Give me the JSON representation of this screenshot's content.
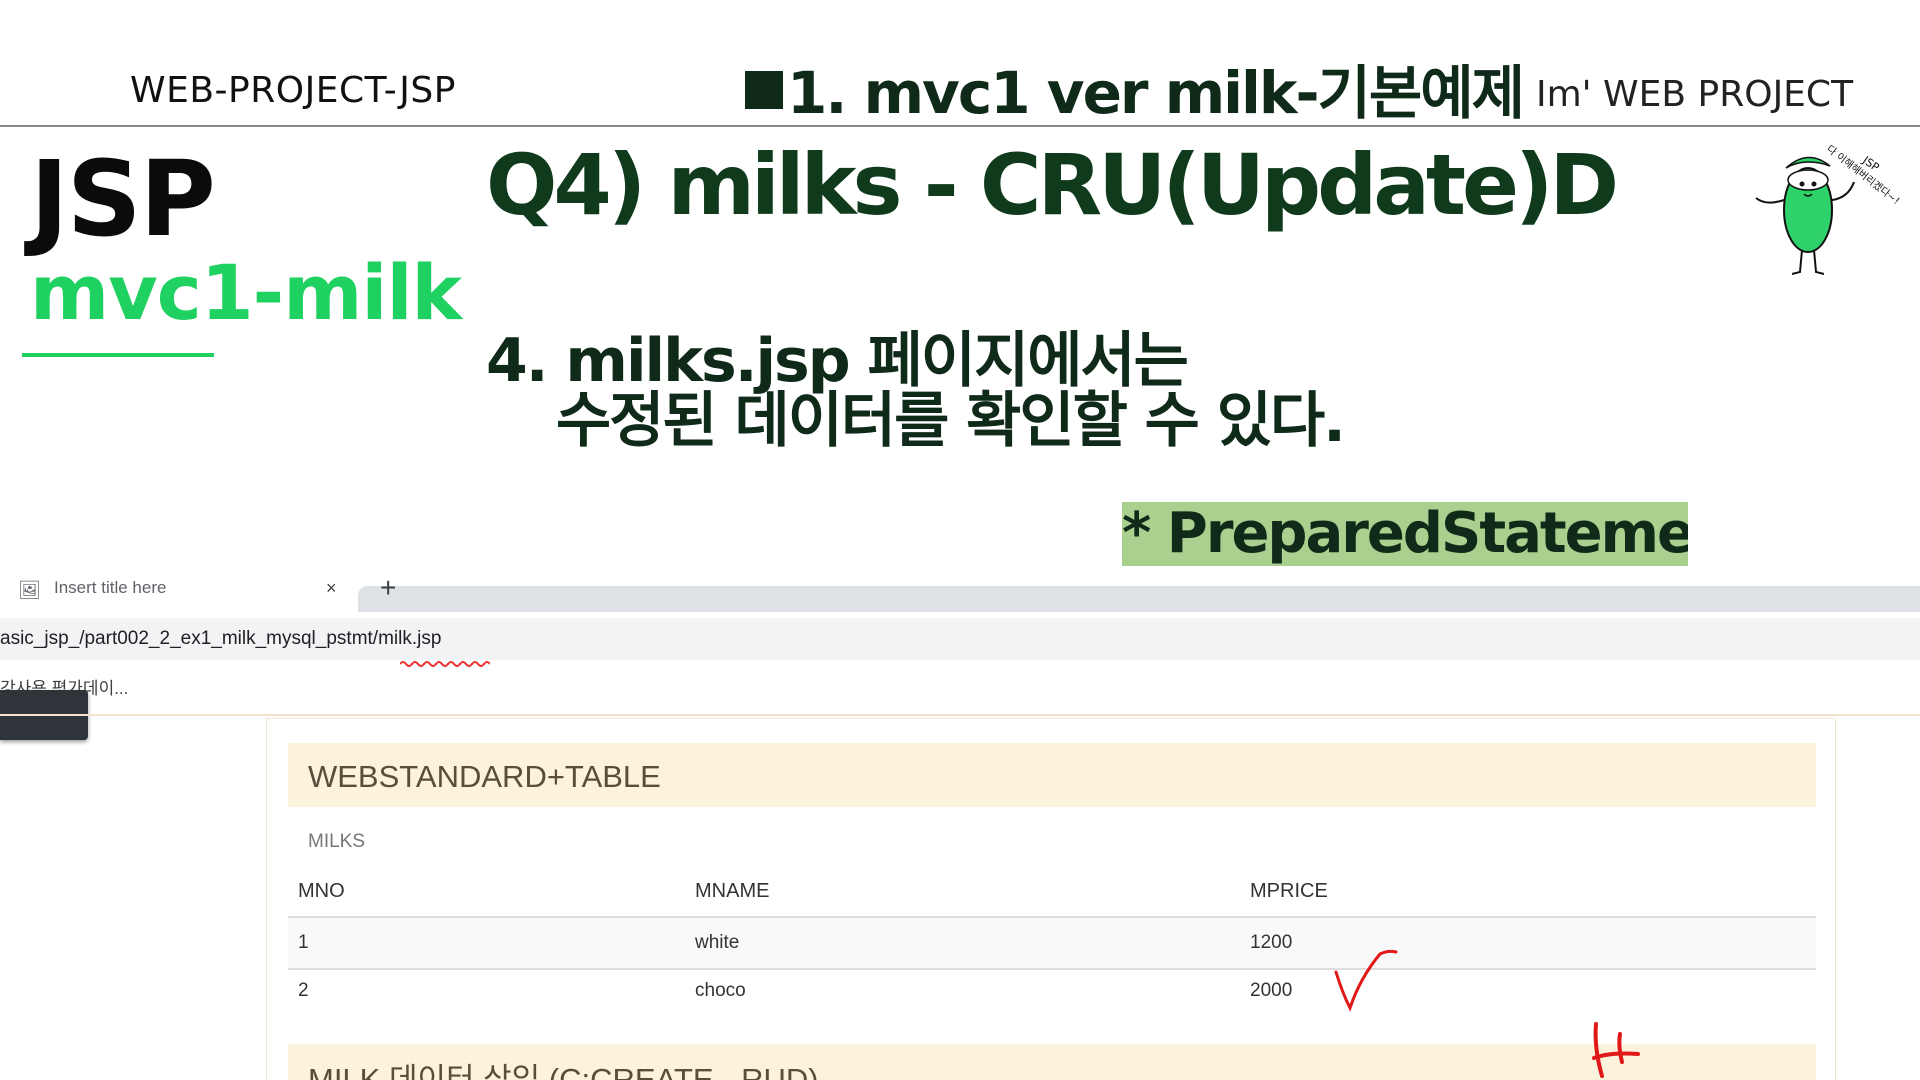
{
  "slide": {
    "header_left": "WEB-PROJECT-JSP",
    "header_center": "1. mvc1 ver  milk-기본예제",
    "header_right": "Im'  WEB PROJECT",
    "jsp_title": "JSP",
    "project_title": "mvc1-milk",
    "question_title": "Q4) milks - CRU(Update)D",
    "step_line1": "4. milks.jsp 페이지에서는",
    "step_line2": "수정된 데이터를 확인할 수 있다.",
    "badge": "* PreparedStatement",
    "mascot_caption": "다 이해해버리겠다~!",
    "mascot_label": "JSP",
    "colors": {
      "accent_green": "#1fd160",
      "dark_green": "#0f2a19",
      "badge_bg": "#a9d08e"
    }
  },
  "browser": {
    "tab_title": "Insert title here",
    "tab_close": "×",
    "new_tab": "+",
    "url": "asic_jsp_/part002_2_ex1_milk_mysql_pstmt/milk.jsp",
    "bookmark": "강사용 평가데이..."
  },
  "page": {
    "panel_heading": "WEBSTANDARD+TABLE",
    "table": {
      "caption": "MILKS",
      "headers": [
        "MNO",
        "MNAME",
        "MPRICE"
      ],
      "rows": [
        [
          "1",
          "white",
          "1200"
        ],
        [
          "2",
          "choco",
          "2000"
        ]
      ]
    },
    "insert_heading": "MILK 데이터 삽입 (C:CREATE - RUD)"
  }
}
